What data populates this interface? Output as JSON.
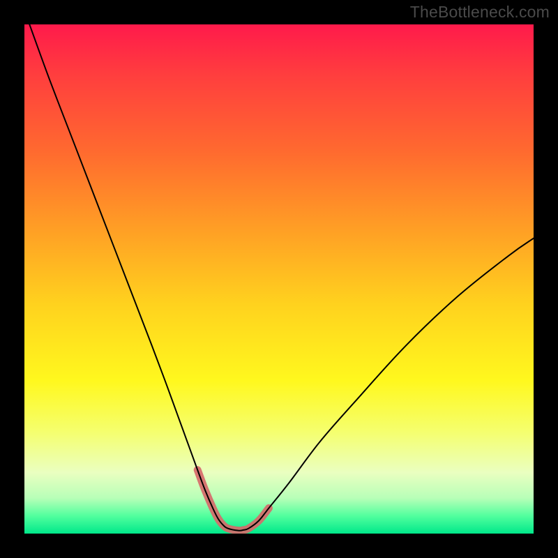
{
  "watermark": "TheBottleneck.com",
  "chart_data": {
    "type": "line",
    "title": "",
    "xlabel": "",
    "ylabel": "",
    "xlim": [
      0,
      100
    ],
    "ylim": [
      0,
      100
    ],
    "background_gradient": {
      "stops": [
        {
          "offset": 0.0,
          "color": "#ff1a4b"
        },
        {
          "offset": 0.1,
          "color": "#ff3e3e"
        },
        {
          "offset": 0.25,
          "color": "#ff6a2f"
        },
        {
          "offset": 0.4,
          "color": "#ff9e25"
        },
        {
          "offset": 0.55,
          "color": "#ffd21e"
        },
        {
          "offset": 0.7,
          "color": "#fff81e"
        },
        {
          "offset": 0.8,
          "color": "#f5ff6e"
        },
        {
          "offset": 0.88,
          "color": "#eaffc0"
        },
        {
          "offset": 0.93,
          "color": "#b8ffb8"
        },
        {
          "offset": 0.965,
          "color": "#52ff9e"
        },
        {
          "offset": 1.0,
          "color": "#00e88a"
        }
      ]
    },
    "series": [
      {
        "name": "bottleneck-curve",
        "stroke": "#000000",
        "stroke_width": 2,
        "x": [
          1,
          5,
          10,
          15,
          20,
          25,
          28,
          30,
          32,
          34,
          35.5,
          37,
          38,
          39,
          40,
          42,
          43,
          44,
          46,
          48,
          52,
          58,
          65,
          75,
          85,
          95,
          100
        ],
        "y": [
          100,
          89,
          76,
          63,
          50,
          37,
          29,
          23.5,
          18,
          12.5,
          8.5,
          5,
          3,
          1.7,
          1,
          0.6,
          0.7,
          1,
          2.5,
          5,
          10,
          18,
          26,
          37,
          46.5,
          54.5,
          58
        ]
      },
      {
        "name": "highlight-band",
        "stroke": "#d66a6a",
        "stroke_width": 11,
        "linecap": "round",
        "x": [
          34,
          35.5,
          37,
          38,
          39,
          40,
          42,
          43,
          44,
          46,
          48
        ],
        "y": [
          12.5,
          8.5,
          5,
          3,
          1.7,
          1,
          0.6,
          0.7,
          1,
          2.5,
          5
        ]
      }
    ]
  }
}
